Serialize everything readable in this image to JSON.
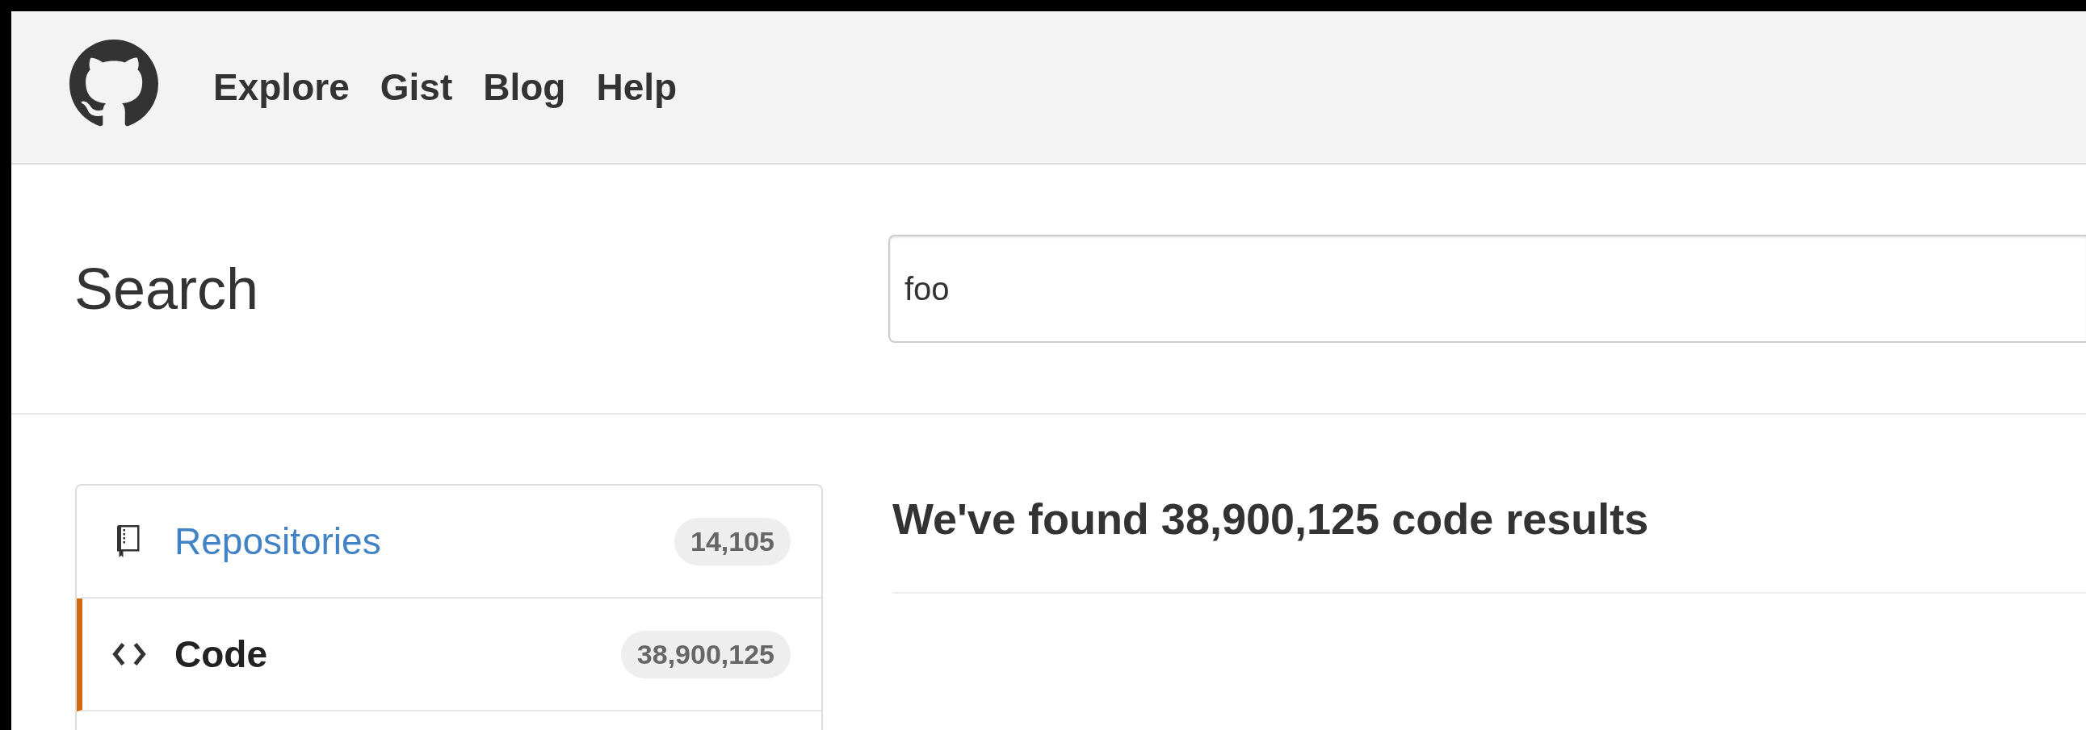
{
  "nav": {
    "items": [
      "Explore",
      "Gist",
      "Blog",
      "Help"
    ]
  },
  "search": {
    "title": "Search",
    "value": "foo"
  },
  "sidebar": {
    "items": [
      {
        "kind": "repo",
        "label": "Repositories",
        "count": "14,105",
        "selected": false
      },
      {
        "kind": "code",
        "label": "Code",
        "count": "38,900,125",
        "selected": true
      }
    ]
  },
  "results": {
    "heading": "We've found 38,900,125 code results"
  }
}
